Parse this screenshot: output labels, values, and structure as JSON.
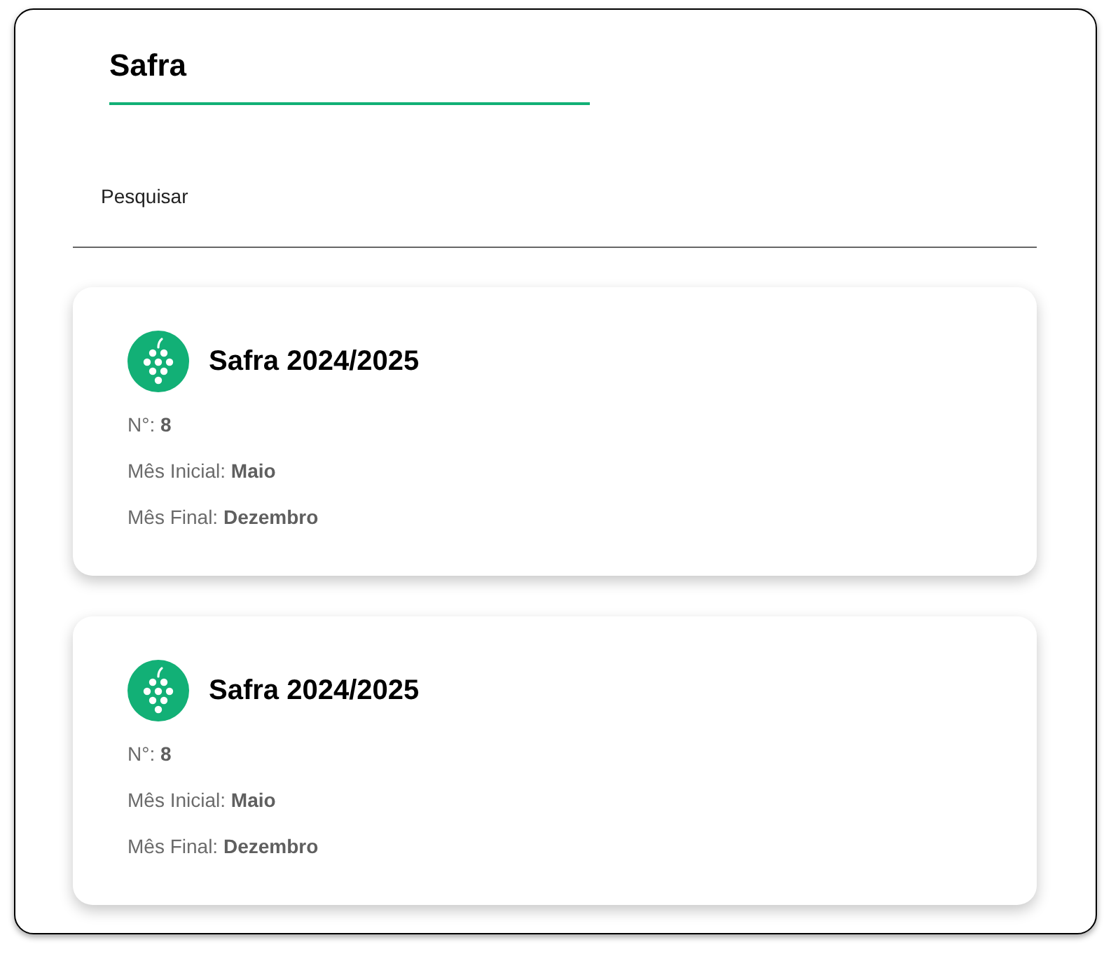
{
  "page": {
    "title": "Safra"
  },
  "search": {
    "placeholder": "Pesquisar"
  },
  "cards": [
    {
      "title": "Safra 2024/2025",
      "fields": [
        "N°: **8**",
        "Mês Inicial: **Maio**",
        "Mês Final: **Dezembro**"
      ]
    },
    {
      "title": "Safra 2024/2025",
      "fields": [
        "N°: **8**",
        "Mês Inicial: **Maio**",
        "Mês Final: **Dezembro**"
      ]
    }
  ]
}
